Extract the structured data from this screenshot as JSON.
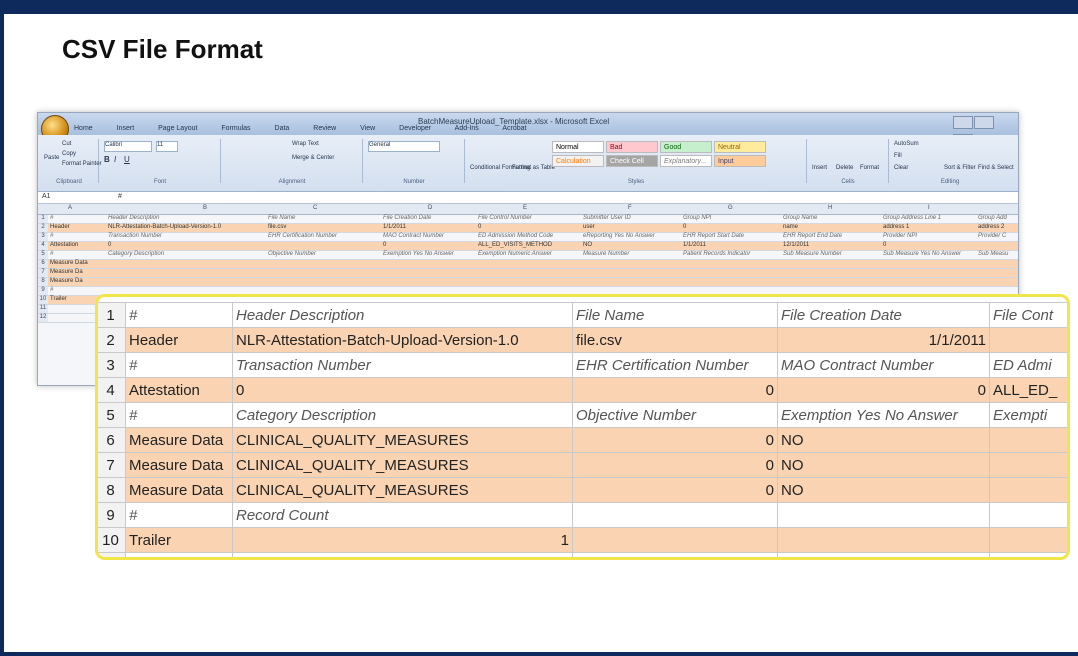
{
  "slide": {
    "title": "CSV File Format"
  },
  "excel_window": {
    "title": "BatchMeasureUpload_Template.xlsx - Microsoft Excel",
    "tabs": [
      "Home",
      "Insert",
      "Page Layout",
      "Formulas",
      "Data",
      "Review",
      "View",
      "Developer",
      "Add-Ins",
      "Acrobat"
    ],
    "clipboard": {
      "cut": "Cut",
      "copy": "Copy",
      "paste": "Paste",
      "format_painter": "Format Painter",
      "label": "Clipboard"
    },
    "font": {
      "name": "Calibri",
      "size": "11",
      "label": "Font"
    },
    "alignment": {
      "wrap": "Wrap Text",
      "merge": "Merge & Center",
      "label": "Alignment"
    },
    "number": {
      "format": "General",
      "label": "Number"
    },
    "styles": {
      "cond": "Conditional Formatting",
      "format_table": "Format as Table",
      "normal": "Normal",
      "bad": "Bad",
      "good": "Good",
      "neutral": "Neutral",
      "calculation": "Calculation",
      "check_cell": "Check Cell",
      "explanatory": "Explanatory...",
      "input": "Input",
      "label": "Styles"
    },
    "cells": {
      "insert": "Insert",
      "delete": "Delete",
      "format": "Format",
      "label": "Cells"
    },
    "editing": {
      "autosum": "AutoSum",
      "fill": "Fill",
      "clear": "Clear",
      "sort": "Sort & Filter",
      "find": "Find & Select",
      "label": "Editing"
    },
    "name_box": "A1",
    "formula": "#",
    "columns": [
      "A",
      "B",
      "C",
      "D",
      "E",
      "F",
      "G",
      "H",
      "I"
    ],
    "rows": [
      {
        "n": "1",
        "orange": false,
        "cells": [
          "#",
          "Header Description",
          "File Name",
          "File Creation Date",
          "File Control Number",
          "Submitter User ID",
          "Group NPI",
          "Group Name",
          "Group Address Line 1",
          "Group Add"
        ]
      },
      {
        "n": "2",
        "orange": true,
        "cells": [
          "Header",
          "NLR-Attestation-Batch-Upload-Version-1.0",
          "file.csv",
          "1/1/2011",
          "0",
          "user",
          "0",
          "name",
          "address 1",
          "address 2"
        ]
      },
      {
        "n": "3",
        "orange": false,
        "cells": [
          "#",
          "Transaction Number",
          "EHR Certification Number",
          "MAO Contract Number",
          "ED Admission Method Code",
          "eReporting Yes No Answer",
          "EHR Report Start Date",
          "EHR Report End Date",
          "Provider NPI",
          "Provider C"
        ]
      },
      {
        "n": "4",
        "orange": true,
        "cells": [
          "Attestation",
          "0",
          "",
          "0",
          "ALL_ED_VISITS_METHOD",
          "NO",
          "1/1/2011",
          "12/1/2011",
          "0",
          ""
        ]
      },
      {
        "n": "5",
        "orange": false,
        "cells": [
          "#",
          "Category Description",
          "Objective Number",
          "Exemption Yes No Answer",
          "Exemption Numeric Answer",
          "Measure Number",
          "Patient Records Indicator",
          "Sub Measure Number",
          "Sub Measure Yes No Answer",
          "Sub Measu"
        ]
      },
      {
        "n": "6",
        "orange": true,
        "cells": [
          "Measure Data",
          "",
          "",
          "",
          "",
          "",
          "",
          "",
          "",
          ""
        ]
      },
      {
        "n": "7",
        "orange": true,
        "cells": [
          "Measure Da",
          "",
          "",
          "",
          "",
          "",
          "",
          "",
          "",
          ""
        ]
      },
      {
        "n": "8",
        "orange": true,
        "cells": [
          "Measure Da",
          "",
          "",
          "",
          "",
          "",
          "",
          "",
          "",
          ""
        ]
      },
      {
        "n": "9",
        "orange": false,
        "cells": [
          "#",
          "",
          "",
          "",
          "",
          "",
          "",
          "",
          "",
          ""
        ]
      },
      {
        "n": "10",
        "orange": true,
        "cells": [
          "Trailer",
          "",
          "",
          "",
          "",
          "",
          "",
          "",
          "",
          ""
        ]
      },
      {
        "n": "11",
        "orange": false,
        "cells": [
          "",
          "",
          "",
          "",
          "",
          "",
          "",
          "",
          "",
          ""
        ]
      },
      {
        "n": "12",
        "orange": false,
        "cells": [
          "",
          "",
          "",
          "",
          "",
          "",
          "",
          "",
          "",
          ""
        ]
      }
    ]
  },
  "zoom_table": {
    "rows": [
      {
        "n": "1",
        "orange": false,
        "cells": [
          {
            "t": "#",
            "cls": "it"
          },
          {
            "t": "Header Description",
            "cls": "it"
          },
          {
            "t": "File Name",
            "cls": "it"
          },
          {
            "t": "File Creation Date",
            "cls": "it"
          },
          {
            "t": "File Cont",
            "cls": "it"
          }
        ]
      },
      {
        "n": "2",
        "orange": true,
        "cells": [
          {
            "t": "Header",
            "cls": ""
          },
          {
            "t": "NLR-Attestation-Batch-Upload-Version-1.0",
            "cls": ""
          },
          {
            "t": "file.csv",
            "cls": ""
          },
          {
            "t": "1/1/2011",
            "cls": "num"
          },
          {
            "t": "",
            "cls": ""
          }
        ]
      },
      {
        "n": "3",
        "orange": false,
        "cells": [
          {
            "t": "#",
            "cls": "it"
          },
          {
            "t": "Transaction Number",
            "cls": "it"
          },
          {
            "t": "EHR Certification Number",
            "cls": "it"
          },
          {
            "t": "MAO Contract Number",
            "cls": "it"
          },
          {
            "t": "ED Admi",
            "cls": "it"
          }
        ]
      },
      {
        "n": "4",
        "orange": true,
        "cells": [
          {
            "t": "Attestation",
            "cls": ""
          },
          {
            "t": "0",
            "cls": ""
          },
          {
            "t": "0",
            "cls": "num"
          },
          {
            "t": "0",
            "cls": "num"
          },
          {
            "t": "ALL_ED_",
            "cls": ""
          }
        ]
      },
      {
        "n": "5",
        "orange": false,
        "cells": [
          {
            "t": "#",
            "cls": "it"
          },
          {
            "t": "Category Description",
            "cls": "it"
          },
          {
            "t": "Objective Number",
            "cls": "it"
          },
          {
            "t": "Exemption Yes No Answer",
            "cls": "it"
          },
          {
            "t": "Exempti",
            "cls": "it"
          }
        ]
      },
      {
        "n": "6",
        "orange": true,
        "cells": [
          {
            "t": "Measure Data",
            "cls": ""
          },
          {
            "t": "CLINICAL_QUALITY_MEASURES",
            "cls": ""
          },
          {
            "t": "0",
            "cls": "num"
          },
          {
            "t": "NO",
            "cls": ""
          },
          {
            "t": "",
            "cls": ""
          }
        ]
      },
      {
        "n": "7",
        "orange": true,
        "cells": [
          {
            "t": "Measure Data",
            "cls": ""
          },
          {
            "t": "CLINICAL_QUALITY_MEASURES",
            "cls": ""
          },
          {
            "t": "0",
            "cls": "num"
          },
          {
            "t": "NO",
            "cls": ""
          },
          {
            "t": "",
            "cls": ""
          }
        ]
      },
      {
        "n": "8",
        "orange": true,
        "cells": [
          {
            "t": "Measure Data",
            "cls": ""
          },
          {
            "t": "CLINICAL_QUALITY_MEASURES",
            "cls": ""
          },
          {
            "t": "0",
            "cls": "num"
          },
          {
            "t": "NO",
            "cls": ""
          },
          {
            "t": "",
            "cls": ""
          }
        ]
      },
      {
        "n": "9",
        "orange": false,
        "cells": [
          {
            "t": "#",
            "cls": "it"
          },
          {
            "t": "Record Count",
            "cls": "it"
          },
          {
            "t": "",
            "cls": ""
          },
          {
            "t": "",
            "cls": ""
          },
          {
            "t": "",
            "cls": ""
          }
        ]
      },
      {
        "n": "10",
        "orange": true,
        "cells": [
          {
            "t": "Trailer",
            "cls": ""
          },
          {
            "t": "1",
            "cls": "num"
          },
          {
            "t": "",
            "cls": ""
          },
          {
            "t": "",
            "cls": ""
          },
          {
            "t": "",
            "cls": ""
          }
        ]
      },
      {
        "n": "11",
        "orange": false,
        "cells": [
          {
            "t": "",
            "cls": ""
          },
          {
            "t": "",
            "cls": ""
          },
          {
            "t": "",
            "cls": ""
          },
          {
            "t": "",
            "cls": ""
          },
          {
            "t": "",
            "cls": ""
          }
        ]
      }
    ]
  }
}
